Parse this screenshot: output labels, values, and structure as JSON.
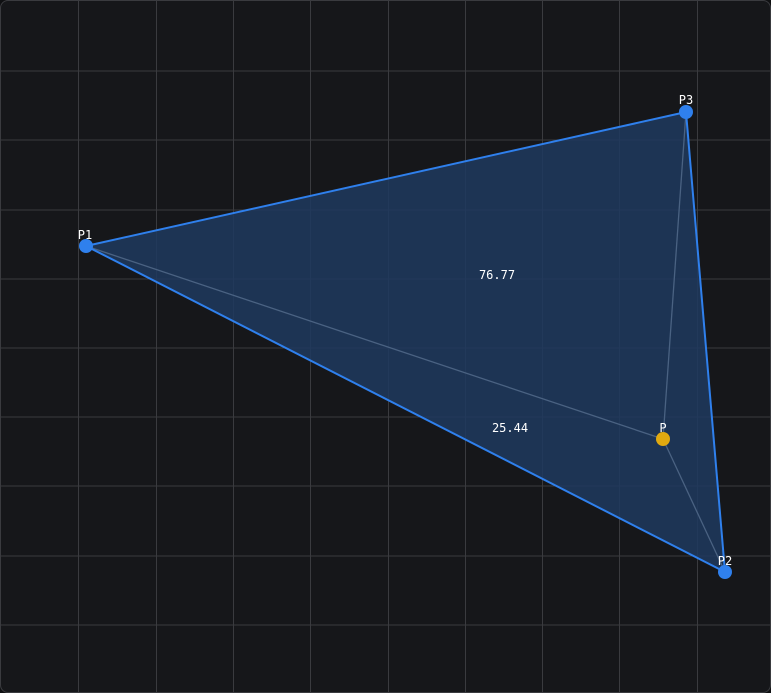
{
  "colors": {
    "background": "#16171a",
    "grid": "#3a3b3f",
    "triangle_edge": "#2f80ed",
    "triangle_fill": "#1e3a5f",
    "inner_line": "#4a6282",
    "vertex": "#2f80ed",
    "point": "#e0a910",
    "label": "#ffffff"
  },
  "vertices": {
    "p1": {
      "label": "P1"
    },
    "p2": {
      "label": "P2"
    },
    "p3": {
      "label": "P3"
    },
    "p": {
      "label": "P"
    }
  },
  "areas": {
    "upper": "76.77",
    "lower": "25.44"
  }
}
